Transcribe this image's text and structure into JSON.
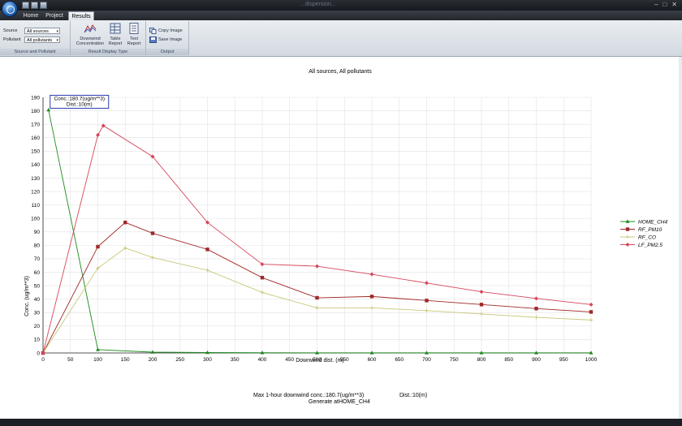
{
  "window": {
    "title": "...dispersion...",
    "controls": [
      "–",
      "□",
      "✕"
    ]
  },
  "tabs": [
    {
      "label": "Home",
      "active": false
    },
    {
      "label": "Project",
      "active": false
    },
    {
      "label": "Results",
      "active": true
    }
  ],
  "ribbon": {
    "source_group": {
      "label": "Source and Pollutant",
      "source_label": "Source",
      "source_value": "All sources",
      "pollutant_label": "Pollutant",
      "pollutant_value": "All pollutants"
    },
    "display_group": {
      "label": "Result Display Type",
      "downwind_l1": "Downwind",
      "downwind_l2": "Concentration",
      "table_l1": "Table",
      "table_l2": "Report",
      "text_l1": "Text",
      "text_l2": "Report"
    },
    "output_group": {
      "label": "Output",
      "copy_label": "Copy Image",
      "save_label": "Save Image"
    }
  },
  "chart_data": {
    "type": "line",
    "title": "All sources, All pollutants",
    "xlabel": "Downwind dist. (m)",
    "ylabel": "Conc. (ug/m**3)",
    "xlim": [
      0,
      1000
    ],
    "ylim": [
      0,
      190
    ],
    "xticks": [
      0,
      50,
      100,
      150,
      200,
      250,
      300,
      350,
      400,
      450,
      500,
      550,
      600,
      650,
      700,
      750,
      800,
      850,
      900,
      950,
      1000
    ],
    "yticks": [
      0,
      10,
      20,
      30,
      40,
      50,
      60,
      70,
      80,
      90,
      100,
      110,
      120,
      130,
      140,
      150,
      160,
      170,
      180,
      190
    ],
    "grid": true,
    "legend_position": "right",
    "series": [
      {
        "name": "HOME_CH4",
        "color": "#1a8a1a",
        "marker": "triangle",
        "x": [
          10,
          100,
          200,
          300,
          400,
          500,
          600,
          700,
          800,
          900,
          1000
        ],
        "y": [
          180.7,
          2.5,
          0.6,
          0.3,
          0.2,
          0.1,
          0.1,
          0.1,
          0.1,
          0.1,
          0.1
        ]
      },
      {
        "name": "RF_PM10",
        "color": "#a02828",
        "marker": "square",
        "x": [
          0,
          100,
          150,
          200,
          300,
          400,
          500,
          600,
          700,
          800,
          900,
          1000
        ],
        "y": [
          0,
          79,
          97,
          89,
          77,
          56,
          41,
          42,
          39,
          36,
          33,
          30.5
        ]
      },
      {
        "name": "RF_CO",
        "color": "#c8c87a",
        "marker": "plus",
        "x": [
          0,
          100,
          150,
          200,
          300,
          400,
          500,
          600,
          700,
          800,
          900,
          1000
        ],
        "y": [
          0,
          63,
          78,
          71,
          61.5,
          45,
          33.5,
          33.5,
          31.5,
          29,
          26.5,
          24.5
        ]
      },
      {
        "name": "LF_PM2.5",
        "color": "#d6455a",
        "marker": "diamond",
        "x": [
          0,
          100,
          110,
          200,
          300,
          400,
          500,
          600,
          700,
          800,
          900,
          1000
        ],
        "y": [
          0,
          162,
          169,
          146,
          97,
          66,
          64.5,
          58.5,
          52,
          45.5,
          40.5,
          36
        ]
      }
    ],
    "annotation": {
      "line1": "Conc.:180.7(ug/m**3)",
      "line2": "Dist.:10(m)",
      "x": 10,
      "y": 180.7
    }
  },
  "summary": {
    "max_text": "Max 1-hour downwind conc.:180.7(ug/m**3)",
    "dist_text": "Dist.:10(m)",
    "generate_text": "Generate atHOME_CH4"
  }
}
